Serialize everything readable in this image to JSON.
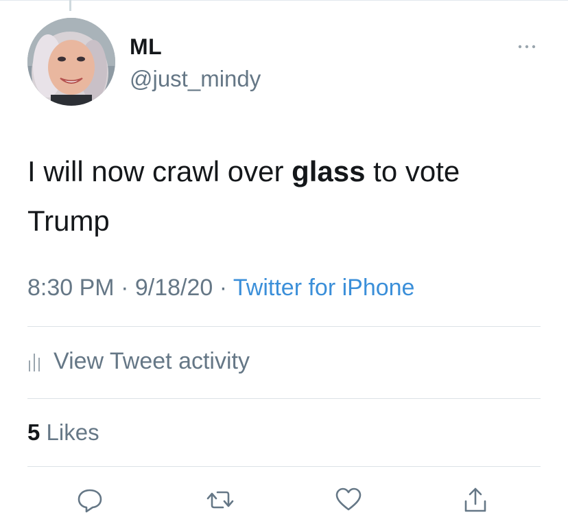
{
  "tweet": {
    "author": {
      "display_name": "ML",
      "handle": "@just_mindy"
    },
    "text": {
      "part1": "I will now crawl over ",
      "bold": "glass",
      "part2": " to vote Trump"
    },
    "time": "8:30 PM",
    "separator": " · ",
    "date": "9/18/20",
    "source": "Twitter for iPhone",
    "activity_label": "View Tweet activity",
    "likes_count": "5",
    "likes_label": " Likes"
  },
  "colors": {
    "text": "#14171a",
    "secondary": "#657786",
    "link": "#3b8fd9",
    "divider": "#dbe1e6"
  },
  "icons": {
    "more": "more-dots-icon",
    "activity": "bar-chart-icon",
    "reply": "reply-bubble-icon",
    "retweet": "retweet-icon",
    "like": "heart-icon",
    "share": "share-icon"
  }
}
